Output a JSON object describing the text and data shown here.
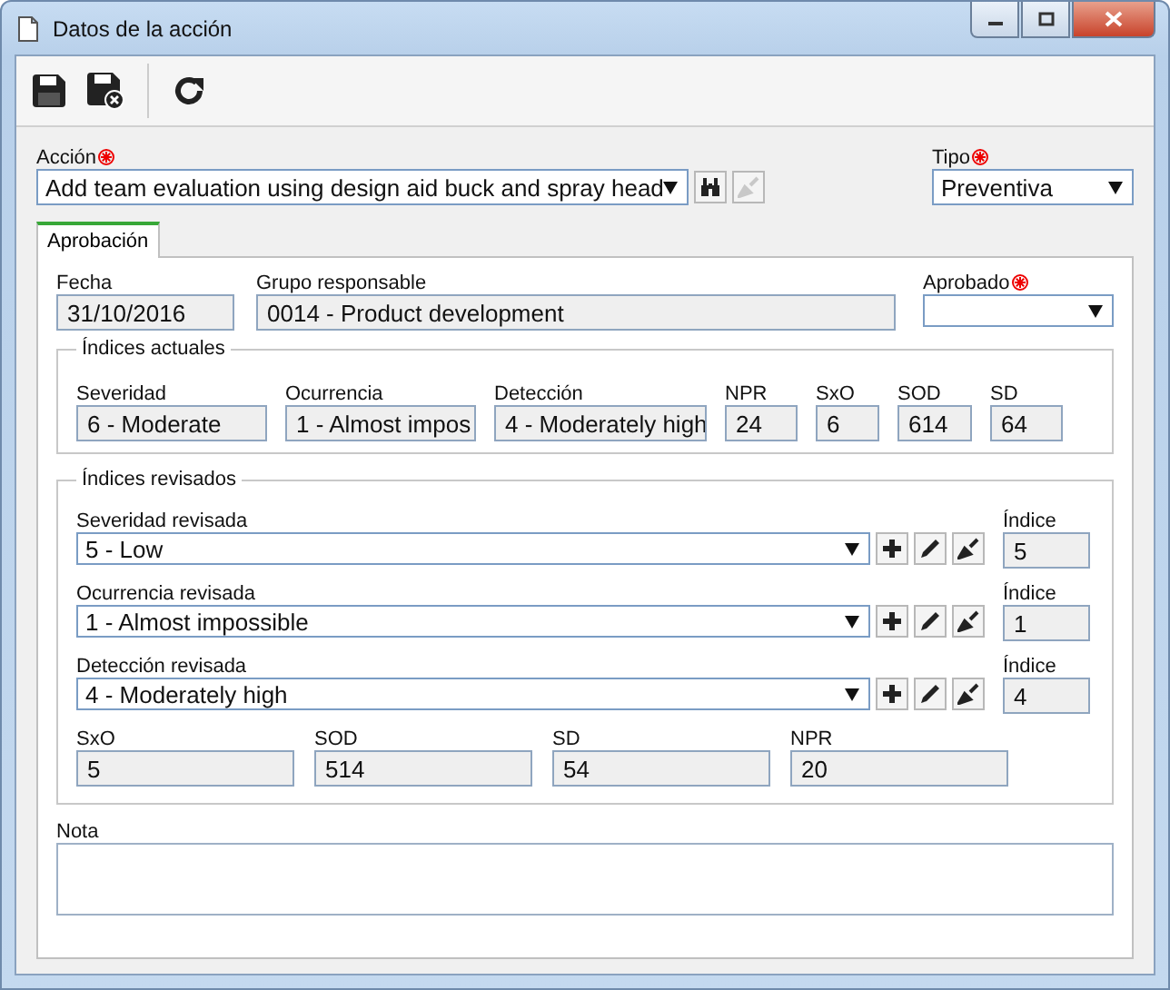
{
  "window": {
    "title": "Datos de la acción"
  },
  "accion": {
    "label": "Acción",
    "required": true,
    "value": "Add team evaluation using design aid buck and spray head",
    "buttons": [
      {
        "kind": "search",
        "disabled": false
      },
      {
        "kind": "clear",
        "disabled": true
      }
    ]
  },
  "tipo": {
    "label": "Tipo",
    "required": true,
    "value": "Preventiva"
  },
  "tabs": [
    {
      "label": "Aprobación",
      "selected": true
    }
  ],
  "fecha": {
    "label": "Fecha",
    "value": "31/10/2016"
  },
  "grupo": {
    "label": "Grupo responsable",
    "value": "0014 - Product development"
  },
  "aprobado": {
    "label": "Aprobado",
    "required": true
  },
  "actuales": {
    "title": "Índices actuales",
    "fields": [
      {
        "label": "Severidad",
        "value": "6 - Moderate"
      },
      {
        "label": "Ocurrencia",
        "value": "1 - Almost impos"
      },
      {
        "label": "Detección",
        "value": "4 - Moderately high"
      },
      {
        "label": "NPR",
        "value": "24"
      },
      {
        "label": "SxO",
        "value": "6"
      },
      {
        "label": "SOD",
        "value": "614"
      },
      {
        "label": "SD",
        "value": "64"
      }
    ]
  },
  "revisados": {
    "title": "Índices revisados",
    "rows": [
      {
        "label": "Severidad revisada",
        "value": "5 - Low",
        "index_label": "Índice",
        "index_value": "5"
      },
      {
        "label": "Ocurrencia revisada",
        "value": "1 - Almost impossible",
        "index_label": "Índice",
        "index_value": "1"
      },
      {
        "label": "Detección revisada",
        "value": "4 - Moderately high",
        "index_label": "Índice",
        "index_value": "4"
      }
    ],
    "totals": [
      {
        "label": "SxO",
        "value": "5"
      },
      {
        "label": "SOD",
        "value": "514"
      },
      {
        "label": "SD",
        "value": "54"
      },
      {
        "label": "NPR",
        "value": "20"
      }
    ]
  },
  "nota": {
    "label": "Nota"
  }
}
